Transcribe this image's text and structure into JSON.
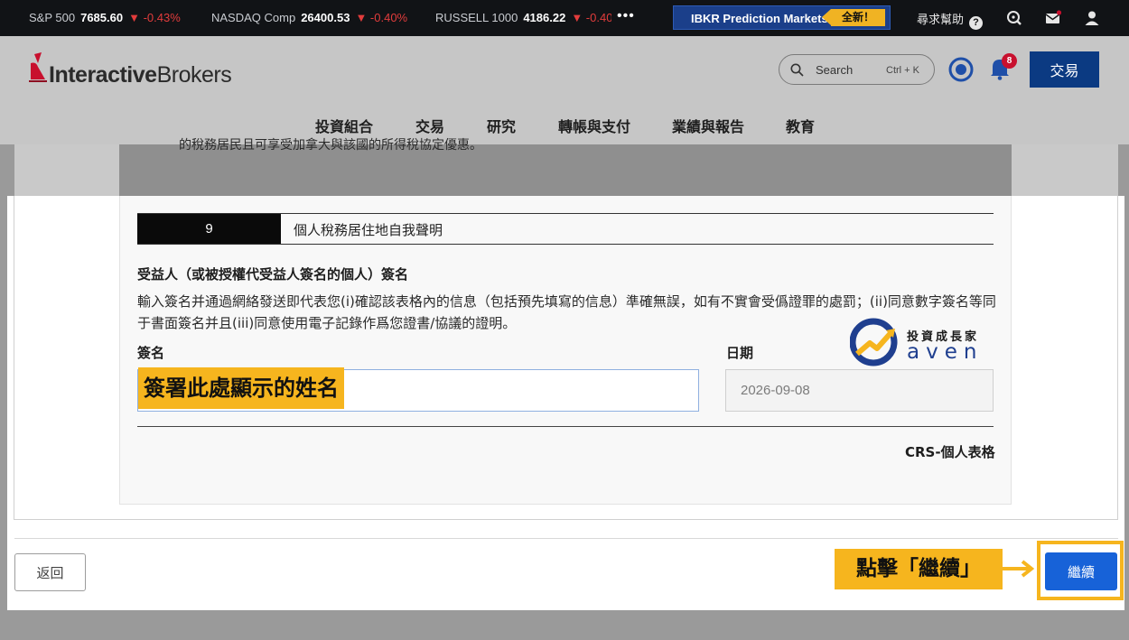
{
  "ticker": [
    {
      "name": "S&P 500",
      "value": "7685.60",
      "change": "▼ -0.43%"
    },
    {
      "name": "NASDAQ Comp",
      "value": "26400.53",
      "change": "▼ -0.40%"
    },
    {
      "name": "RUSSELL 1000",
      "value": "4186.22",
      "change": "▼ -0.40"
    }
  ],
  "ticker_more": "•••",
  "promo": {
    "label": "IBKR Prediction Markets",
    "badge": "全新！"
  },
  "help_label": "尋求幫助",
  "help_icon": "?",
  "header": {
    "logo_bold": "Interactive",
    "logo_rest": "Brokers",
    "search_label": "Search",
    "search_shortcut": "Ctrl + K",
    "notification_count": "8",
    "trade_button": "交易"
  },
  "nav": [
    "投資組合",
    "交易",
    "研究",
    "轉帳與支付",
    "業績與報告",
    "教育"
  ],
  "truncated_text": "的稅務居民且可享受加拿大與該國的所得稅協定優惠。",
  "section": {
    "number": "9",
    "title": "個人稅務居住地自我聲明"
  },
  "signature": {
    "heading": "受益人（或被授權代受益人簽名的個人）簽名",
    "description": "輸入簽名并通過網絡發送即代表您(i)確認該表格內的信息（包括預先填寫的信息）準確無誤，如有不實會受僞證罪的處罰；(ii)同意數字簽名等同于書面簽名并且(iii)同意使用電子記錄作爲您證書/協議的證明。",
    "sign_label": "簽名",
    "sign_highlight": "簽署此處顯示的姓名",
    "date_label": "日期",
    "date_value": "2026-09-08",
    "form_name": "CRS-個人表格"
  },
  "watermark": {
    "cn": "投資成長家",
    "en": "aven"
  },
  "footer": {
    "back_button": "返回",
    "annotation": "點擊「繼續」",
    "continue_button": "繼續"
  },
  "colors": {
    "ticker_bg": "#111316",
    "header_bg": "#c6c6c6",
    "brand_red": "#c8102e",
    "trade_blue": "#0b3a82",
    "continue_blue": "#1762d8",
    "highlight_yellow": "#f6b51e",
    "down_red": "#e23c3c"
  }
}
